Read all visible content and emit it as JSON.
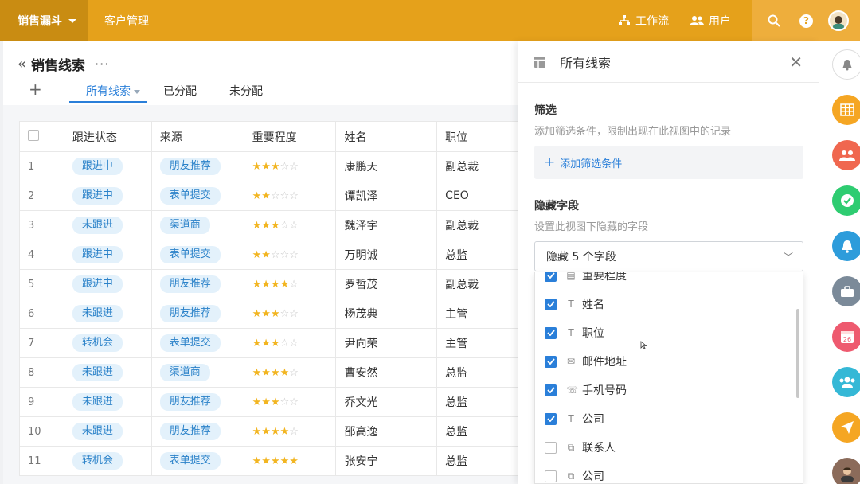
{
  "topbar": {
    "app_name": "销售漏斗",
    "nav_customers": "客户管理",
    "workflow": "工作流",
    "users": "用户",
    "help": "?"
  },
  "page": {
    "title": "销售线索",
    "more": "···",
    "add": "+",
    "tabs": [
      "所有线索",
      "已分配",
      "未分配"
    ]
  },
  "table": {
    "columns": [
      "跟进状态",
      "来源",
      "重要程度",
      "姓名",
      "职位"
    ],
    "rows": [
      {
        "n": "1",
        "status": "跟进中",
        "source": "朋友推荐",
        "stars": 3,
        "name": "康鹏天",
        "title": "副总裁"
      },
      {
        "n": "2",
        "status": "跟进中",
        "source": "表单提交",
        "stars": 2,
        "name": "谭凯泽",
        "title": "CEO"
      },
      {
        "n": "3",
        "status": "未跟进",
        "source": "渠道商",
        "stars": 3,
        "name": "魏泽宇",
        "title": "副总裁"
      },
      {
        "n": "4",
        "status": "跟进中",
        "source": "表单提交",
        "stars": 2,
        "name": "万明诚",
        "title": "总监"
      },
      {
        "n": "5",
        "status": "跟进中",
        "source": "朋友推荐",
        "stars": 4,
        "name": "罗哲茂",
        "title": "副总裁"
      },
      {
        "n": "6",
        "status": "未跟进",
        "source": "朋友推荐",
        "stars": 3,
        "name": "杨茂典",
        "title": "主管"
      },
      {
        "n": "7",
        "status": "转机会",
        "source": "表单提交",
        "stars": 3,
        "name": "尹向荣",
        "title": "主管"
      },
      {
        "n": "8",
        "status": "未跟进",
        "source": "渠道商",
        "stars": 4,
        "name": "曹安然",
        "title": "总监"
      },
      {
        "n": "9",
        "status": "未跟进",
        "source": "朋友推荐",
        "stars": 3,
        "name": "乔文光",
        "title": "总监"
      },
      {
        "n": "10",
        "status": "未跟进",
        "source": "朋友推荐",
        "stars": 4,
        "name": "邵高逸",
        "title": "总监"
      },
      {
        "n": "11",
        "status": "转机会",
        "source": "表单提交",
        "stars": 5,
        "name": "张安宁",
        "title": "总监"
      }
    ]
  },
  "panel": {
    "title": "所有线索",
    "filter_title": "筛选",
    "filter_desc": "添加筛选条件，限制出现在此视图中的记录",
    "add_filter": "添加筛选条件",
    "hide_title": "隐藏字段",
    "hide_desc": "设置此视图下隐藏的字段",
    "hide_select": "隐藏 5 个字段",
    "fields": [
      {
        "label": "重要程度",
        "checked": true,
        "icon": "rating-icon"
      },
      {
        "label": "姓名",
        "checked": true,
        "icon": "text-icon"
      },
      {
        "label": "职位",
        "checked": true,
        "icon": "text-icon"
      },
      {
        "label": "邮件地址",
        "checked": true,
        "icon": "mail-icon"
      },
      {
        "label": "手机号码",
        "checked": true,
        "icon": "phone-icon"
      },
      {
        "label": "公司",
        "checked": true,
        "icon": "text-icon"
      },
      {
        "label": "联系人",
        "checked": false,
        "icon": "link-icon"
      },
      {
        "label": "公司",
        "checked": false,
        "icon": "link-icon"
      }
    ]
  },
  "dock": {
    "calendar_day": "26",
    "colors": [
      "#f5a623",
      "#f0674f",
      "#2ecc71",
      "#2d9cdb",
      "#7b8a99",
      "#ee5a6f",
      "#35b8d6",
      "#f5a623",
      "#8b6b5a"
    ]
  }
}
